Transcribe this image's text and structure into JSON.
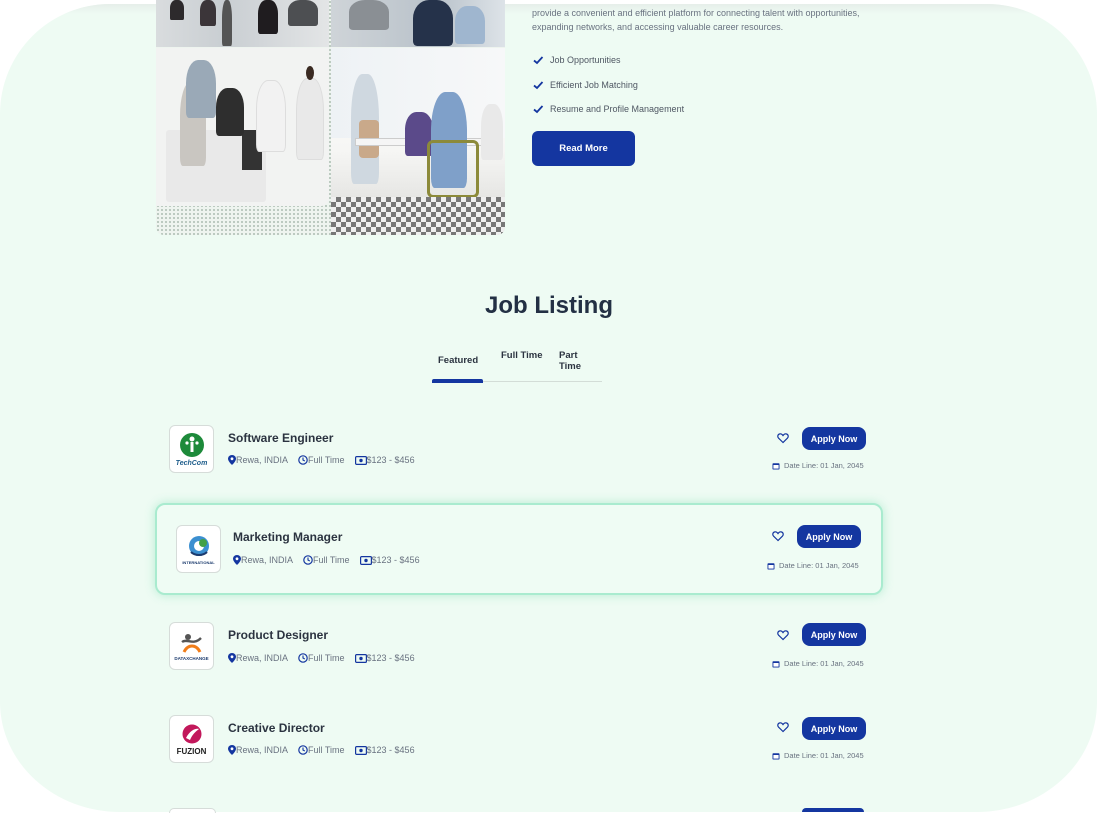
{
  "about": {
    "text": "provide a convenient and efficient platform for connecting talent with opportunities, expanding networks, and accessing valuable career resources.",
    "features": [
      "Job Opportunities",
      "Efficient Job Matching",
      "Resume and Profile Management"
    ],
    "read_more_label": "Read More"
  },
  "job_listing": {
    "title": "Job Listing",
    "tabs": [
      "Featured",
      "Full Time",
      "Part Time"
    ],
    "active_tab": "Featured",
    "jobs": [
      {
        "title": "Software Engineer",
        "company_logo_text": "TechCom",
        "location": "Rewa, INDIA",
        "type": "Full Time",
        "salary": "$123 - $456",
        "apply_label": "Apply Now",
        "deadline": "Date Line: 01 Jan, 2045"
      },
      {
        "title": "Marketing Manager",
        "company_logo_text": "INTERNATIONAL",
        "location": "Rewa, INDIA",
        "type": "Full Time",
        "salary": "$123 - $456",
        "apply_label": "Apply Now",
        "deadline": "Date Line: 01 Jan, 2045"
      },
      {
        "title": "Product Designer",
        "company_logo_text": "DATAXCHANGE",
        "location": "Rewa, INDIA",
        "type": "Full Time",
        "salary": "$123 - $456",
        "apply_label": "Apply Now",
        "deadline": "Date Line: 01 Jan, 2045"
      },
      {
        "title": "Creative Director",
        "company_logo_text": "FUZION",
        "location": "Rewa, INDIA",
        "type": "Full Time",
        "salary": "$123 - $456",
        "apply_label": "Apply Now",
        "deadline": "Date Line: 01 Jan, 2045"
      }
    ]
  },
  "colors": {
    "accent": "#1436a0",
    "background": "#eefbf3",
    "heading": "#233044",
    "muted_text": "#697280",
    "highlight_border": "#a9ebcf"
  },
  "icons": {
    "check": "check-icon",
    "location": "location-pin-icon",
    "clock": "clock-icon",
    "salary": "money-icon",
    "heart": "heart-icon",
    "calendar": "calendar-icon"
  }
}
